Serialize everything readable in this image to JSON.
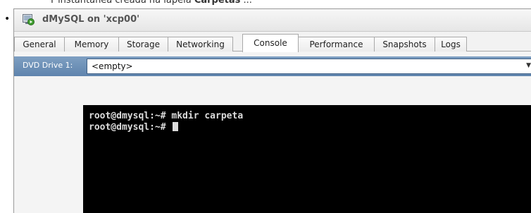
{
  "caption": {
    "prefix": "Y instantánea creada na lapela ",
    "bold": "Carpetas",
    "suffix": " ..."
  },
  "window": {
    "title": "dMySQL on 'xcp00'",
    "icon": "vm-icon"
  },
  "tabs": [
    {
      "label": "General",
      "active": false
    },
    {
      "label": "Memory",
      "active": false
    },
    {
      "label": "Storage",
      "active": false
    },
    {
      "label": "Networking",
      "active": false
    },
    {
      "label": "Console",
      "active": true
    },
    {
      "label": "Performance",
      "active": false
    },
    {
      "label": "Snapshots",
      "active": false
    },
    {
      "label": "Logs",
      "active": false
    }
  ],
  "console": {
    "dvd_label": "DVD Drive 1:",
    "dvd_value": "<empty>"
  },
  "terminal": {
    "lines": [
      "root@dmysql:~# mkdir carpeta",
      "root@dmysql:~# "
    ]
  },
  "colors": {
    "dvd_bar": "#6a8db5",
    "terminal_bg": "#000000",
    "vm_icon_green": "#3f9d2f"
  }
}
